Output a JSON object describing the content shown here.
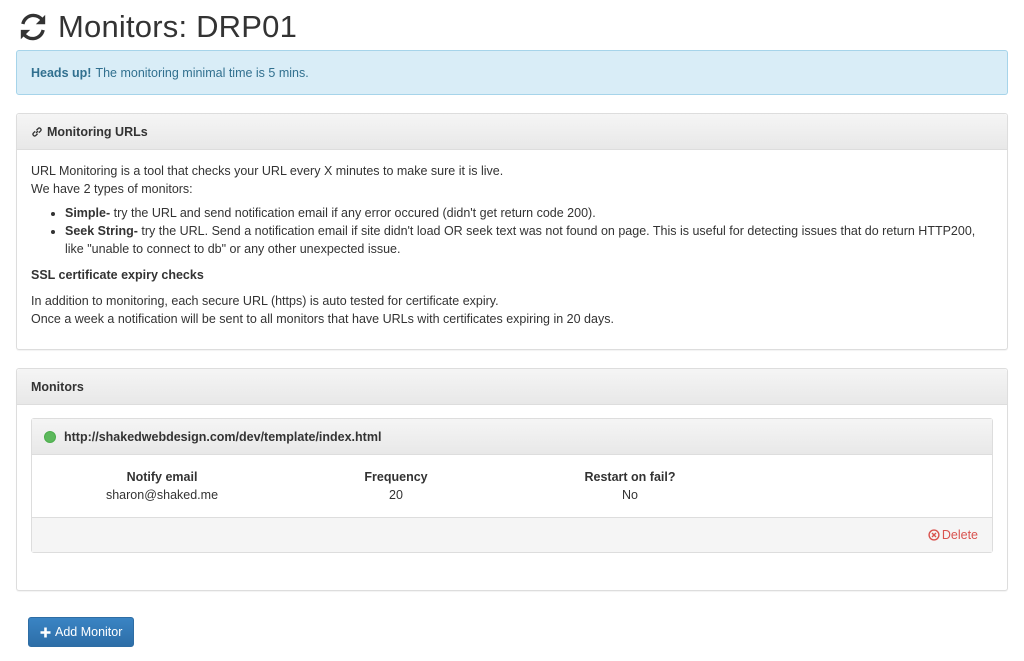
{
  "page": {
    "title": "Monitors: DRP01",
    "title_icon": "refresh-icon"
  },
  "alert": {
    "strong": "Heads up!",
    "text": "The monitoring minimal time is 5 mins."
  },
  "info_panel": {
    "icon": "link-icon",
    "heading": "Monitoring URLs",
    "intro_line1": "URL Monitoring is a tool that checks your URL every X minutes to make sure it is live.",
    "intro_line2": "We have 2 types of monitors:",
    "items": [
      {
        "term": "Simple-",
        "desc": " try the URL and send notification email if any error occured (didn't get return code 200)."
      },
      {
        "term": "Seek String-",
        "desc": " try the URL. Send a notification email if site didn't load OR seek text was not found on page. This is useful for detecting issues that do return HTTP200, like \"unable to connect to db\" or any other unexpected issue."
      }
    ],
    "ssl_heading": "SSL certificate expiry checks",
    "ssl_line1": "In addition to monitoring, each secure URL (https) is auto tested for certificate expiry.",
    "ssl_line2": "Once a week a notification will be sent to all monitors that have URLs with certificates expiring in 20 days."
  },
  "monitors_panel": {
    "heading": "Monitors",
    "monitors": [
      {
        "status_color": "#5cb85c",
        "url": "http://shakedwebdesign.com/dev/template/index.html",
        "notify_label": "Notify email",
        "notify_value": "sharon@shaked.me",
        "frequency_label": "Frequency",
        "frequency_value": "20",
        "restart_label": "Restart on fail?",
        "restart_value": "No",
        "delete_label": "Delete",
        "delete_icon": "close-circle-icon"
      }
    ]
  },
  "add_button": {
    "label": "Add Monitor",
    "icon": "plus-icon"
  },
  "colors": {
    "primary": "#337ab7",
    "info_bg": "#d9edf7",
    "info_text": "#31708f",
    "danger": "#d9534f",
    "success": "#5cb85c"
  }
}
